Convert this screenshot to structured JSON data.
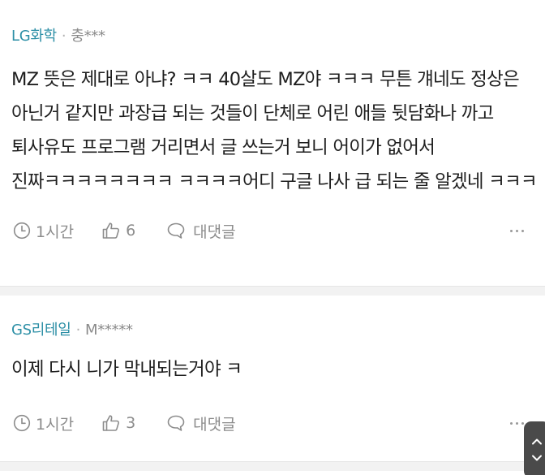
{
  "comments": [
    {
      "company": "LG화학",
      "separator": "·",
      "user": "충***",
      "text": "MZ 뜻은 제대로 아냐? ㅋㅋ 40살도 MZ야 ㅋㅋㅋ 무튼 걔네도 정상은 아닌거 같지만 과장급 되는 것들이 단체로 어린 애들 뒷담화나 까고 퇴사유도 프로그램 거리면서 글 쓰는거 보니 어이가 없어서 진짜ㅋㅋㅋㅋㅋㅋㅋㅋ ㅋㅋㅋㅋ어디 구글 나사 급 되는 줄 알겠네 ㅋㅋㅋ",
      "time": "1시간",
      "likes": "6",
      "reply_label": "대댓글"
    },
    {
      "company": "GS리테일",
      "separator": "·",
      "user": "M*****",
      "text": "이제 다시 니가 막내되는거야 ㅋ",
      "time": "1시간",
      "likes": "3",
      "reply_label": "대댓글"
    }
  ],
  "icons": {
    "time": "clock-icon",
    "like": "thumbs-up-icon",
    "reply": "speech-bubble-icon",
    "more": "more-dots-icon",
    "scroll": "scroll-up-down-icon"
  },
  "colors": {
    "company_text": "#2c8fa6",
    "meta_text": "#8c8c8c",
    "divider": "#f2f2f2",
    "scroll_button": "#4a4a4a"
  }
}
